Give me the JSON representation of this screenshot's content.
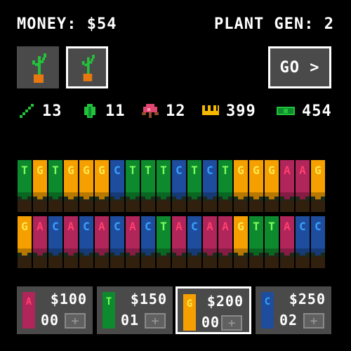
{
  "header": {
    "money_label": "MONEY: $54",
    "plant_gen_label": "PLANT GEN: 2"
  },
  "go_button": {
    "label": "GO >"
  },
  "stats": [
    {
      "icon": "stick-icon",
      "value": "13",
      "color": "#22c33a"
    },
    {
      "icon": "leaf-icon",
      "value": "11",
      "color": "#22c33a"
    },
    {
      "icon": "flower-icon",
      "value": "12",
      "color": "#e0466f"
    },
    {
      "icon": "crown-icon",
      "value": "399",
      "color": "#f5b800"
    },
    {
      "icon": "cash-icon",
      "value": "454",
      "color": "#22c33a"
    }
  ],
  "genome": {
    "row1": [
      "T",
      "G",
      "T",
      "G",
      "G",
      "G",
      "C",
      "T",
      "T",
      "T",
      "C",
      "T",
      "C",
      "T",
      "G",
      "G",
      "G",
      "A",
      "A",
      "G"
    ],
    "row2": [
      "G",
      "A",
      "C",
      "A",
      "C",
      "A",
      "C",
      "A",
      "C",
      "T",
      "A",
      "C",
      "A",
      "A",
      "G",
      "T",
      "T",
      "A",
      "C",
      "C"
    ]
  },
  "colors": {
    "A": "#b0255a",
    "C": "#1e4d9e",
    "G": "#f5a000",
    "T": "#0e8a2e",
    "letterA": "#ff3f6f",
    "letterC": "#39a0ff",
    "letterG": "#ffe84d",
    "letterT": "#7dff5a"
  },
  "shop": [
    {
      "base": "A",
      "price": "$100",
      "count": "00",
      "plus": "+"
    },
    {
      "base": "T",
      "price": "$150",
      "count": "01",
      "plus": "+"
    },
    {
      "base": "G",
      "price": "$200",
      "count": "00",
      "plus": "+"
    },
    {
      "base": "C",
      "price": "$250",
      "count": "02",
      "plus": "+"
    }
  ]
}
